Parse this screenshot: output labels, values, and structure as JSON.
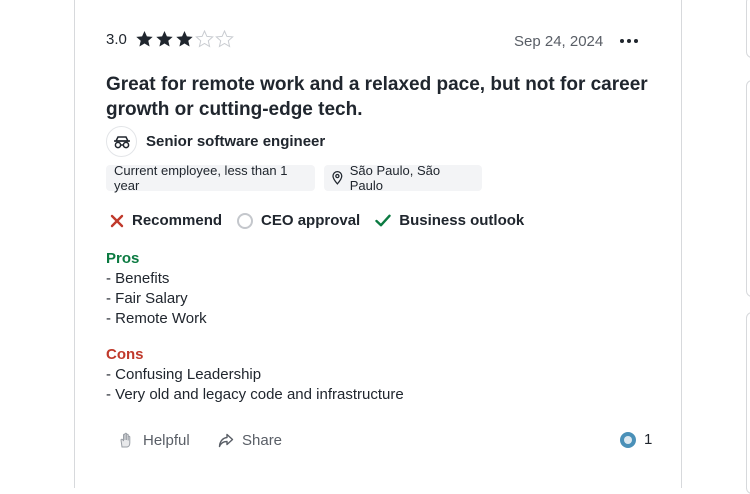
{
  "review": {
    "rating": "3.0",
    "stars_filled": 3,
    "stars_total": 5,
    "date": "Sep 24, 2024",
    "title": "Great for remote work and a relaxed pace, but not for career growth or cutting-edge tech.",
    "role": "Senior software engineer",
    "employment_status": "Current employee, less than 1 year",
    "location": "São Paulo, São Paulo",
    "ratings": {
      "recommend": "Recommend",
      "ceo_approval": "CEO approval",
      "business_outlook": "Business outlook"
    },
    "pros": {
      "label": "Pros",
      "lines": [
        "- Benefits",
        "- Fair Salary",
        "- Remote Work"
      ]
    },
    "cons": {
      "label": "Cons",
      "lines": [
        "- Confusing Leadership",
        "- Very old and legacy code and infrastructure"
      ]
    },
    "actions": {
      "helpful": "Helpful",
      "share": "Share",
      "helpful_count": "1"
    }
  },
  "colors": {
    "star": "#20262e",
    "pros": "#0b7a41",
    "cons": "#c0392b",
    "check": "#0b7a41",
    "cross": "#c0392b"
  },
  "icons": [
    "star-icon",
    "more-options-icon",
    "role-icon",
    "location-pin-icon",
    "cross-icon",
    "neutral-circle-icon",
    "check-icon",
    "helpful-hand-icon",
    "share-icon",
    "voter-avatar-icon"
  ]
}
